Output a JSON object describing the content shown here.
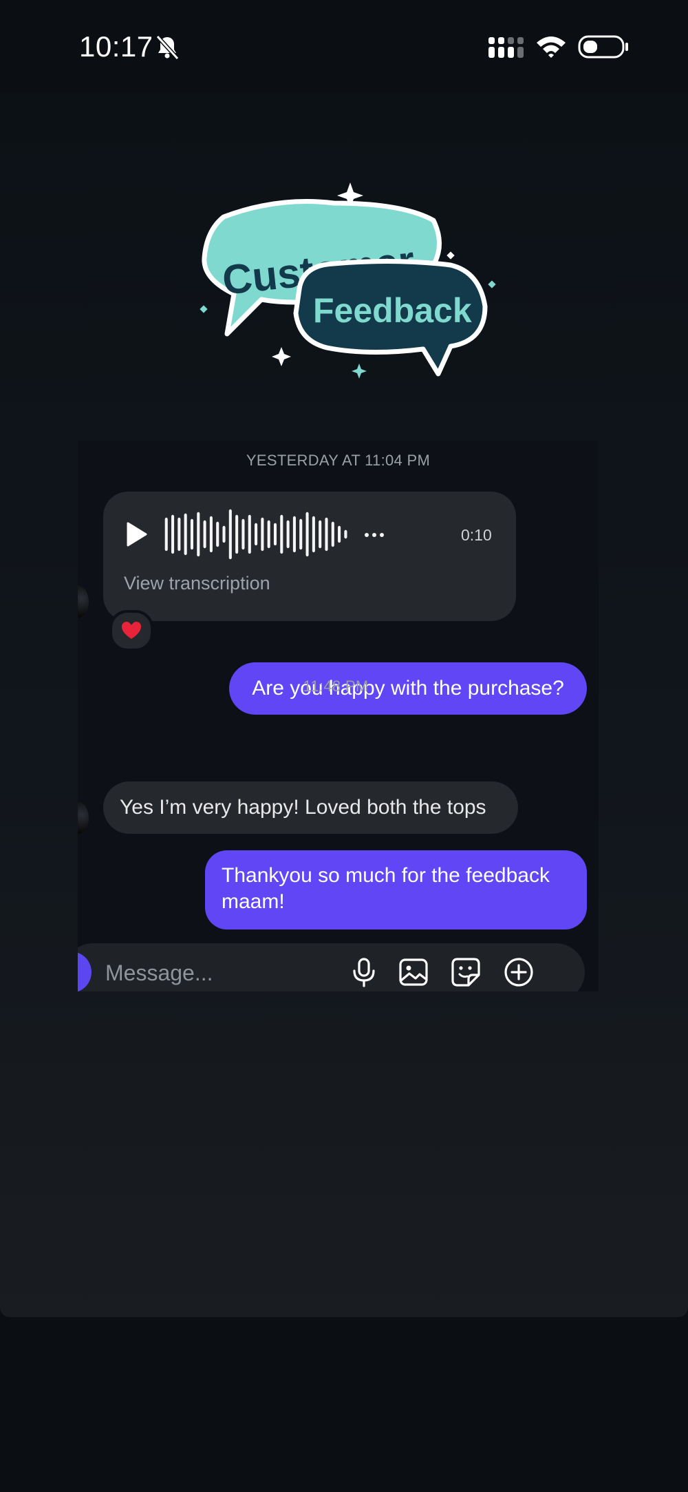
{
  "status_bar": {
    "time": "10:17"
  },
  "sticker": {
    "line1": "Customer",
    "line2": "Feedback"
  },
  "chat": {
    "timestamp_1": "YESTERDAY AT 11:04 PM",
    "voice_message": {
      "duration": "0:10",
      "transcription_link": "View transcription",
      "reaction": "heart"
    },
    "outgoing_1": "Are you happy with the purchase?",
    "timestamp_2": "11:48 PM",
    "incoming_2": "Yes I’m very happy! Loved both the tops",
    "outgoing_2_line1": "Thankyou so much for the feedback",
    "outgoing_2_line2": "maam!"
  },
  "composer": {
    "placeholder": "Message..."
  },
  "colors": {
    "accent": "#6046f5",
    "incoming_bubble": "#25282d",
    "sticker_teal": "#7fd9cf",
    "sticker_navy": "#123a4a"
  }
}
